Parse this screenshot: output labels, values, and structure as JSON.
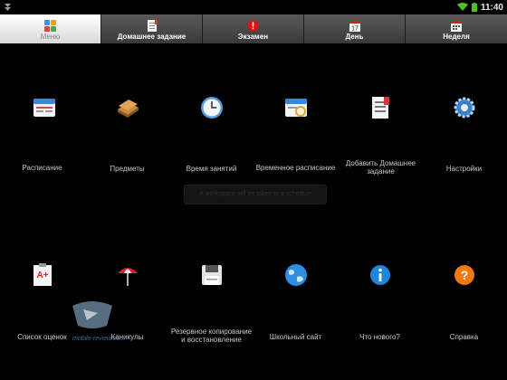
{
  "statusbar": {
    "time": "11:40"
  },
  "tabs": [
    {
      "label": "Меню",
      "icon": "menu-icon",
      "active": true
    },
    {
      "label": "Домашнее задание",
      "icon": "homework-icon",
      "active": false
    },
    {
      "label": "Экзамен",
      "icon": "exam-icon",
      "active": false
    },
    {
      "label": "День",
      "icon": "day-calendar-icon",
      "active": false
    },
    {
      "label": "Неделя",
      "icon": "week-calendar-icon",
      "active": false
    }
  ],
  "grid": {
    "schedule": "Расписание",
    "subjects": "Предметы",
    "class_time": "Время занятий",
    "temp_schedule": "Временное расписание",
    "add_homework": "Добавить Домашнее задание",
    "settings": "Настройки",
    "grades": "Список оценок",
    "holidays": "Каникулы",
    "backup": "Резервное копирование и восстановление",
    "school_site": "Школьный сайт",
    "whats_new": "Что нового?",
    "help": "Справка"
  },
  "toast": "A workspace will be taken to a schedule",
  "watermark": "mobile-review.com",
  "colors": {
    "active_tab": "#ffffff",
    "inactive_tab": "#4a4a4a",
    "exam_red": "#e01010",
    "help_orange": "#f07a10",
    "info_blue": "#1f86d9"
  }
}
